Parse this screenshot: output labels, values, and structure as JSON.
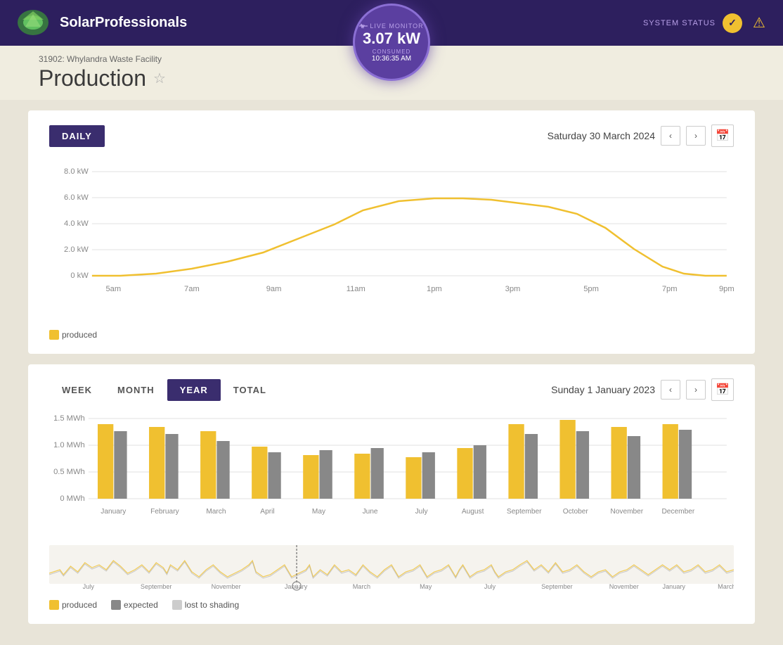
{
  "header": {
    "logo_text_bold": "Solar",
    "logo_text_rest": "Professionals",
    "live_monitor_label": "LIVE MONITOR",
    "live_monitor_kw": "3.07 kW",
    "consumed_label": "CONSUMED",
    "consumed_time": "10:36:35 AM",
    "system_status_label": "SYSTEM STATUS"
  },
  "breadcrumb": "31902: Whylandra Waste Facility",
  "page_title": "Production",
  "daily": {
    "button_label": "DAILY",
    "date": "Saturday 30 March 2024",
    "y_labels": [
      "8.0 kW",
      "6.0 kW",
      "4.0 kW",
      "2.0 kW",
      "0 kW"
    ],
    "x_labels": [
      "5am",
      "7am",
      "9am",
      "11am",
      "1pm",
      "3pm",
      "5pm",
      "7pm",
      "9pm"
    ],
    "legend_produced": "produced"
  },
  "year_chart": {
    "tabs": [
      "WEEK",
      "MONTH",
      "YEAR",
      "TOTAL"
    ],
    "active_tab": "YEAR",
    "date": "Sunday 1 January 2023",
    "y_labels": [
      "1.5 MWh",
      "1.0 MWh",
      "0.5 MWh",
      "0 MWh"
    ],
    "x_labels": [
      "January",
      "February",
      "March",
      "April",
      "May",
      "June",
      "July",
      "August",
      "September",
      "October",
      "November",
      "December"
    ],
    "legend_produced": "produced",
    "legend_expected": "expected",
    "legend_shading": "lost to shading",
    "mini_x_labels": [
      "July",
      "September",
      "November",
      "January",
      "March",
      "May",
      "July",
      "September",
      "November",
      "January",
      "March"
    ]
  },
  "colors": {
    "header_bg": "#2d1f5e",
    "accent_purple": "#5b3fa0",
    "btn_active": "#3a2d6e",
    "gold": "#f0c030",
    "produced_color": "#f0c030",
    "expected_color": "#888888",
    "shading_color": "#cccccc"
  }
}
